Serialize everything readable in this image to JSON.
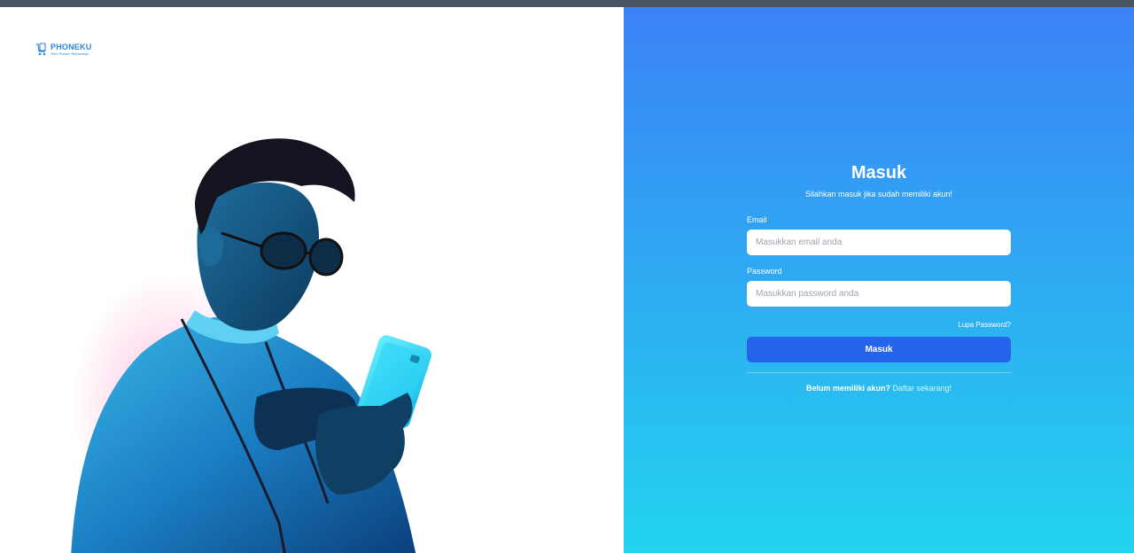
{
  "brand": {
    "name": "PHONEKU",
    "tagline": "Toko Ponsel Terpercaya"
  },
  "login": {
    "title": "Masuk",
    "subtitle": "Silahkan masuk jika sudah memiliki akun!",
    "email_label": "Email",
    "email_placeholder": "Masukkan email anda",
    "password_label": "Password",
    "password_placeholder": "Masukkan password anda",
    "forgot_label": "Lupa Password?",
    "submit_label": "Masuk",
    "register_prompt": "Belum memiliki akun?",
    "register_link": "Daftar sekarang!"
  },
  "colors": {
    "topbar": "#4b5563",
    "gradient_top": "#3b82f6",
    "gradient_bottom": "#22d3ee",
    "button": "#2563eb",
    "brand": "#2b87d8"
  },
  "icons": {
    "logo": "shopping-cart-phone-icon",
    "hero": "person-using-phone-illustration"
  }
}
